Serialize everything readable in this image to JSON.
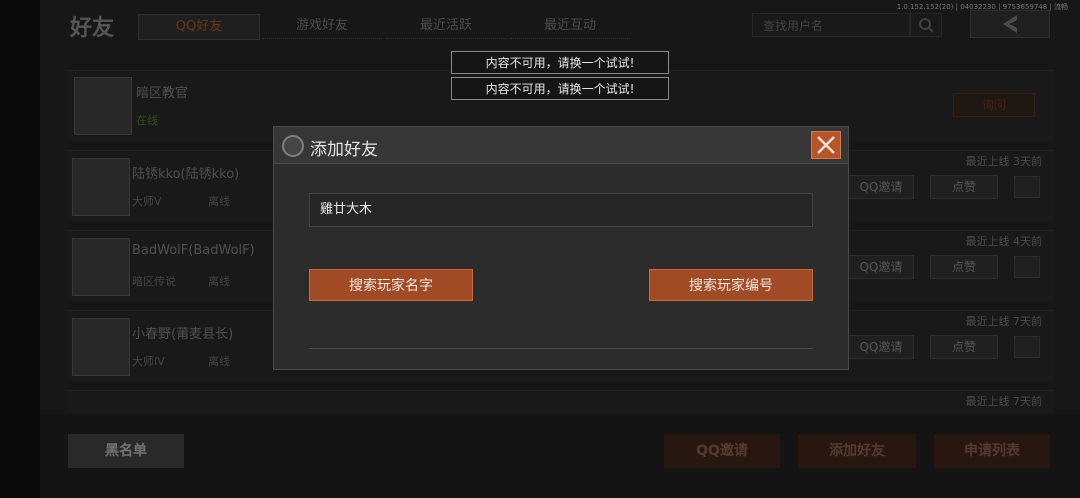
{
  "header": {
    "title": "好友",
    "tabs": [
      "QQ好友",
      "游戏好友",
      "最近活跃",
      "最近互动"
    ],
    "active_tab": 0,
    "version": "1.0.152.152(20) | 04032230 | 9753659748 | 流畅",
    "search_placeholder": "查找用户名"
  },
  "friends": [
    {
      "name": "暗区教官",
      "status": "在线",
      "action": "询问"
    },
    {
      "name": "陆锈kko(陆锈kko)",
      "rank": "大师V",
      "status": "离线",
      "last_online": "最近上线 3天前",
      "invite": "QQ邀请",
      "like": "点赞"
    },
    {
      "name": "BadWolF(BadWolF)",
      "rank": "暗区传说",
      "status": "离线",
      "last_online": "最近上线 4天前",
      "invite": "QQ邀请",
      "like": "点赞"
    },
    {
      "name": "小春野(莆麦县长)",
      "rank": "大师IV",
      "status": "离线",
      "last_online": "最近上线 7天前",
      "invite": "QQ邀请",
      "like": "点赞"
    },
    {
      "name": "",
      "last_online": "最近上线 7天前"
    }
  ],
  "bottom": {
    "blacklist": "黑名单",
    "qq_invite": "QQ邀请",
    "add_friend": "添加好友",
    "request_list": "申请列表"
  },
  "toasts": [
    "内容不可用，请换一个试试!",
    "内容不可用，请换一个试试!"
  ],
  "dialog": {
    "title": "添加好友",
    "input_value": "雞廿大木",
    "search_name_label": "搜索玩家名字",
    "search_id_label": "搜索玩家编号"
  },
  "colors": {
    "accent": "#b9532a",
    "dialog_button": "#a14b26",
    "active_tab_text": "#b8651f"
  }
}
